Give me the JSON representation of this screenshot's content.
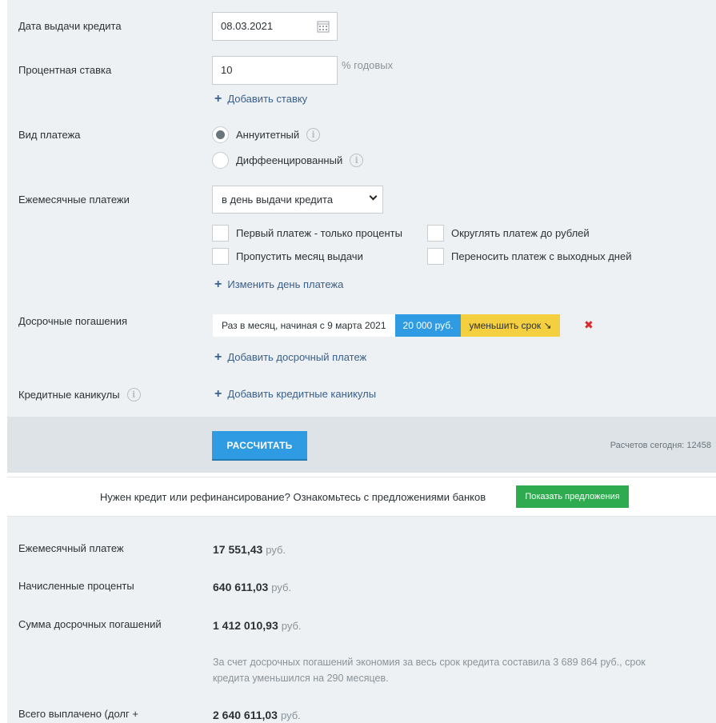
{
  "form": {
    "issue_date": {
      "label": "Дата выдачи кредита",
      "value": "08.03.2021"
    },
    "rate": {
      "label": "Процентная ставка",
      "value": "10",
      "unit": "% годовых",
      "add_link": "Добавить ставку"
    },
    "payment_type": {
      "label": "Вид платежа",
      "options": [
        "Аннуитетный",
        "Диффеенцированный"
      ],
      "selected": "Аннуитетный"
    },
    "monthly": {
      "label": "Ежемесячные платежи",
      "select_value": "в день выдачи кредита",
      "checks": [
        "Первый платеж - только проценты",
        "Округлять платеж до рублей",
        "Пропустить месяц выдачи",
        "Переносить платеж с выходных дней"
      ],
      "change_link": "Изменить день платежа"
    },
    "early": {
      "label": "Досрочные погашения",
      "item": {
        "period": "Раз в месяц, начиная с 9 марта 2021",
        "amount": "20 000 руб.",
        "mode": "уменьшить срок ↘"
      },
      "delete_icon": "✖",
      "add_link": "Добавить досрочный платеж"
    },
    "holidays": {
      "label": "Кредитные каникулы",
      "add_link": "Добавить кредитные каникулы"
    }
  },
  "actions": {
    "calc_label": "РАССЧИТАТЬ",
    "counter": "Расчетов сегодня: 12458"
  },
  "promo": {
    "text": "Нужен кредит или рефинансирование? Ознакомьтесь с предложениями банков",
    "button": "Показать предложения"
  },
  "results": {
    "monthly": {
      "label": "Ежемесячный платеж",
      "value": "17 551,43",
      "cur": "руб."
    },
    "interest": {
      "label": "Начисленные проценты",
      "value": "640 611,03",
      "cur": "руб."
    },
    "early_sum": {
      "label": "Сумма досрочных погашений",
      "value": "1 412 010,93",
      "cur": "руб."
    },
    "note": "За счет досрочных погашений экономия за весь срок кредита составила 3 689 864 руб., срок кредита уменьшился на 290 месяцев.",
    "total": {
      "label": "Всего выплачено (долг +",
      "value": "2 640 611,03",
      "cur": "руб."
    }
  },
  "icons": {
    "plus": "+",
    "info": "i"
  }
}
